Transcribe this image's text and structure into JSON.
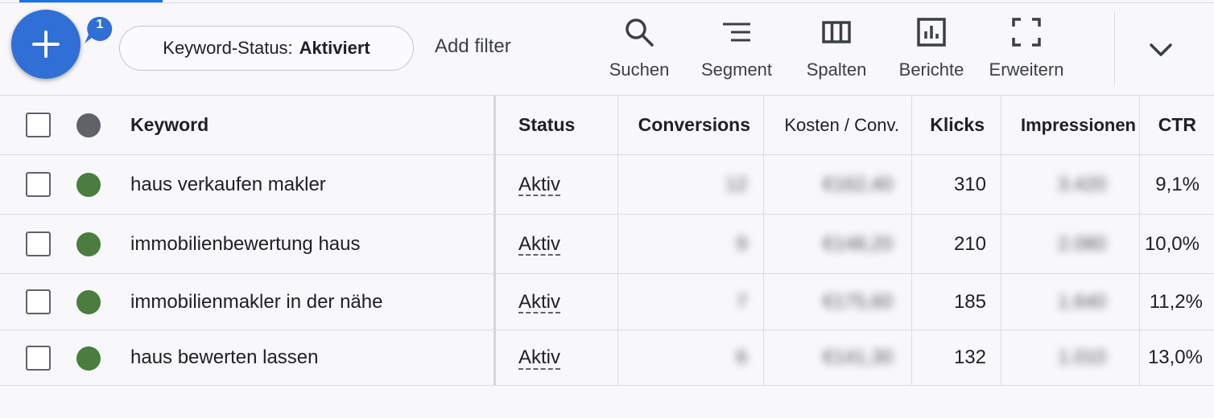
{
  "toolbar": {
    "fab_badge": "1",
    "filter_chip": {
      "label": "Keyword-Status:",
      "value": "Aktiviert"
    },
    "add_filter": "Add filter",
    "tools": {
      "suchen": "Suchen",
      "segment": "Segment",
      "spalten": "Spalten",
      "berichte": "Berichte",
      "erweitern": "Erweitern"
    }
  },
  "table": {
    "headers": {
      "keyword": "Keyword",
      "status": "Status",
      "conversions": "Conversions",
      "cost_per_conv": "Kosten / Conv.",
      "clicks": "Klicks",
      "impressions": "Impressionen",
      "ctr": "CTR"
    },
    "rows": [
      {
        "keyword": "haus verkaufen makler",
        "status": "Aktiv",
        "conversions": "12",
        "cost_per_conv": "€162,40",
        "clicks": "310",
        "impressions": "3.420",
        "ctr": "9,1%"
      },
      {
        "keyword": "immobilienbewertung haus",
        "status": "Aktiv",
        "conversions": "9",
        "cost_per_conv": "€148,20",
        "clicks": "210",
        "impressions": "2.080",
        "ctr": "10,0%"
      },
      {
        "keyword": "immobilienmakler in der nähe",
        "status": "Aktiv",
        "conversions": "7",
        "cost_per_conv": "€175,60",
        "clicks": "185",
        "impressions": "1.640",
        "ctr": "11,2%"
      },
      {
        "keyword": "haus bewerten lassen",
        "status": "Aktiv",
        "conversions": "6",
        "cost_per_conv": "€141,30",
        "clicks": "132",
        "impressions": "1.010",
        "ctr": "13,0%"
      }
    ]
  },
  "colors": {
    "fab": "#2f6fd6",
    "status_dot_active": "#4a7d3e",
    "status_dot_header": "#5f6368"
  },
  "icons": {
    "fab": "plus-icon",
    "suchen": "search-icon",
    "segment": "segment-lines-icon",
    "spalten": "columns-icon",
    "berichte": "bar-chart-icon",
    "erweitern": "fullscreen-icon",
    "more": "chevron-down-icon"
  }
}
